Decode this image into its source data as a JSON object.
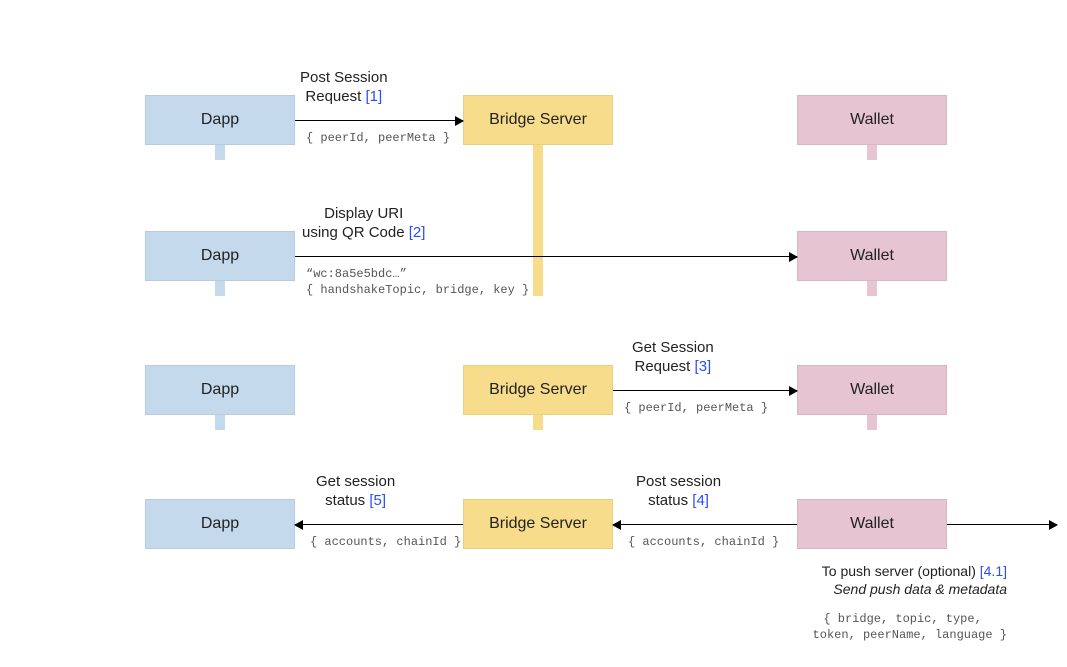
{
  "columns": {
    "dapp": "Dapp",
    "bridge": "Bridge Server",
    "wallet": "Wallet"
  },
  "steps": {
    "one": {
      "label": "Post Session\nRequest",
      "num": "[1]",
      "code": "{ peerId, peerMeta }"
    },
    "two": {
      "label": "Display URI\nusing QR Code",
      "num": "[2]",
      "code": "“wc:8a5e5bdc…”\n{ handshakeTopic, bridge, key }"
    },
    "three": {
      "label": "Get Session\nRequest",
      "num": "[3]",
      "code": "{ peerId, peerMeta }"
    },
    "four": {
      "label": "Post session\nstatus",
      "num": "[4]",
      "code": "{ accounts, chainId }"
    },
    "five": {
      "label": "Get session\nstatus",
      "num": "[5]",
      "code": "{ accounts, chainId }"
    },
    "push": {
      "label": "To push server (optional)",
      "num": "[4.1]",
      "sub": "Send push data & metadata",
      "code": "{ bridge, topic, type,\n  token, peerName, language }"
    }
  }
}
